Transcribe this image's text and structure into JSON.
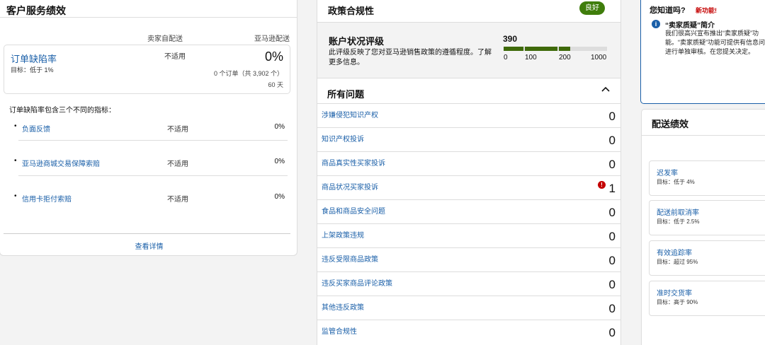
{
  "customer_service": {
    "title": "客户服务绩效",
    "col_seller": "卖家自配送",
    "col_amazon": "亚马逊配送",
    "odr": {
      "name": "订单缺陷率",
      "target": "目标：低于 1%",
      "seller_value": "不适用",
      "amazon_value": "0%",
      "orders": "0 个订单（共 3,902 个）",
      "days": "60 天"
    },
    "intro": "订单缺陷率包含三个不同的指标：",
    "metrics": [
      {
        "label": "负面反馈",
        "seller_value": "不适用",
        "amazon_value": "0%"
      },
      {
        "label": "亚马逊商城交易保障索赔",
        "seller_value": "不适用",
        "amazon_value": "0%"
      },
      {
        "label": "信用卡拒付索赔",
        "seller_value": "不适用",
        "amazon_value": "0%"
      }
    ],
    "view_details": "查看详情"
  },
  "policy": {
    "title": "政策合规性",
    "badge": "良好",
    "rating_title": "账户状况评级",
    "rating_desc": "此评级反映了您对亚马逊销售政策的遵循程度。了解更多信息。",
    "score": "390",
    "ticks": [
      "0",
      "100",
      "200",
      "1000"
    ],
    "all_issues": "所有问题",
    "issues": [
      {
        "label": "涉嫌侵犯知识产权",
        "count": "0"
      },
      {
        "label": "知识产权投诉",
        "count": "0"
      },
      {
        "label": "商品真实性买家投诉",
        "count": "0"
      },
      {
        "label": "商品状况买家投诉",
        "count": "1",
        "alert": "!"
      },
      {
        "label": "食品和商品安全问题",
        "count": "0"
      },
      {
        "label": "上架政策违规",
        "count": "0"
      },
      {
        "label": "违反受限商品政策",
        "count": "0"
      },
      {
        "label": "违反买家商品评论政策",
        "count": "0"
      },
      {
        "label": "其他违反政策",
        "count": "0"
      },
      {
        "label": "监管合规性",
        "count": "0"
      }
    ]
  },
  "did_you_know": {
    "title": "您知道吗?",
    "new_feature": "新功能!",
    "info_glyph": "i",
    "heading": "“卖家质疑”简介",
    "body": "我们很高兴宣布推出“卖家质疑”功能。“卖家质疑”功能可提供有信息问题进行单独审核。在您提关决定。"
  },
  "delivery": {
    "title": "配送绩效",
    "metrics": [
      {
        "name": "迟发率",
        "target": "目标：低于 4%"
      },
      {
        "name": "配送前取消率",
        "target": "目标：低于 2.5%"
      },
      {
        "name": "有效追踪率",
        "target": "目标：超过 95%"
      },
      {
        "name": "准时交货率",
        "target": "目标：高于 90%"
      }
    ]
  },
  "colors": {
    "link": "#1a5fa8",
    "good_badge": "#3f7d0b",
    "bar": "#3f6a0a",
    "alert": "#c40000"
  }
}
